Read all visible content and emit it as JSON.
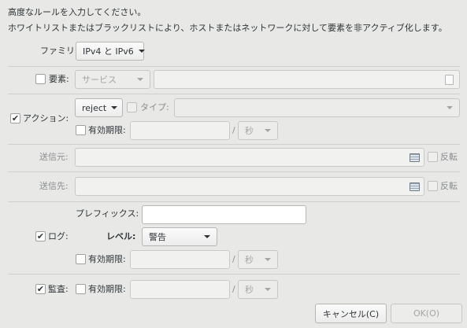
{
  "header": {
    "line1": "高度なルールを入力してください。",
    "line2": "ホワイトリストまたはブラックリストにより、ホストまたはネットワークに対して要素を非アクティブ化します。"
  },
  "family": {
    "label": "ファミリー:",
    "value": "IPv4 と IPv6"
  },
  "element": {
    "label": "要素:",
    "checked": false,
    "type_value": "サービス",
    "entry_value": "",
    "icon": "document-icon"
  },
  "action": {
    "label": "アクション:",
    "checked": true,
    "value": "reject",
    "type_label": "タイプ:",
    "type_value": "",
    "expiry_label": "有効期限:",
    "expiry_value": "",
    "expiry_unit": "秒"
  },
  "source": {
    "label": "送信元:",
    "value": "",
    "icon": "list-icon",
    "invert_label": "反転"
  },
  "destination": {
    "label": "送信先:",
    "value": "",
    "icon": "list-icon",
    "invert_label": "反転"
  },
  "log": {
    "label": "ログ:",
    "checked": true,
    "prefix_label": "プレフィックス:",
    "prefix_value": "",
    "level_label": "レベル:",
    "level_value": "警告",
    "expiry_label": "有効期限:",
    "expiry_value": "",
    "expiry_unit": "秒"
  },
  "audit": {
    "label": "監査:",
    "checked": true,
    "expiry_label": "有効期限:",
    "expiry_value": "",
    "expiry_unit": "秒"
  },
  "buttons": {
    "cancel": "キャンセル(C)",
    "ok": "OK(O)"
  },
  "separator": "/",
  "checkmark": "✔"
}
